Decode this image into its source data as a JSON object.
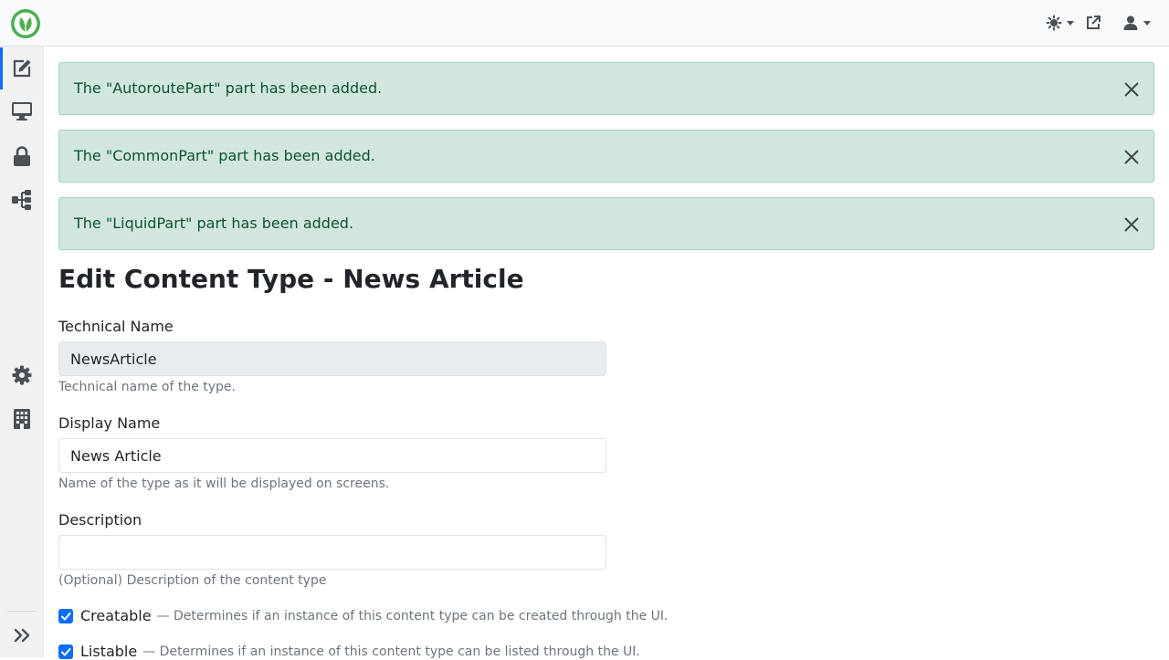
{
  "colors": {
    "accent": "#0d6efd",
    "alert_bg": "#d1e7dd",
    "alert_text": "#0f5132",
    "logo_green": "#4caf50"
  },
  "header": {
    "logo_icon": "leaf-logo-icon",
    "actions": [
      {
        "icon": "theme-toggle-icon",
        "dropdown": true
      },
      {
        "icon": "external-link-icon",
        "dropdown": false
      },
      {
        "icon": "user-icon",
        "dropdown": true
      }
    ]
  },
  "sidebar": {
    "items": [
      {
        "icon": "edit-icon",
        "active": true
      },
      {
        "icon": "desktop-icon",
        "active": false
      },
      {
        "icon": "lock-icon",
        "active": false
      },
      {
        "icon": "workflow-icon",
        "active": false
      },
      {
        "icon": "gear-icon",
        "active": false
      },
      {
        "icon": "building-icon",
        "active": false
      }
    ],
    "collapse_icon": "double-chevron-right-icon"
  },
  "alerts": [
    {
      "message": "The \"AutoroutePart\" part has been added."
    },
    {
      "message": "The \"CommonPart\" part has been added."
    },
    {
      "message": "The \"LiquidPart\" part has been added."
    }
  ],
  "page": {
    "title": "Edit Content Type - News Article"
  },
  "form": {
    "technical_name": {
      "label": "Technical Name",
      "value": "NewsArticle",
      "hint": "Technical name of the type."
    },
    "display_name": {
      "label": "Display Name",
      "value": "News Article",
      "hint": "Name of the type as it will be displayed on screens."
    },
    "description": {
      "label": "Description",
      "value": "",
      "hint": "(Optional) Description of the content type"
    },
    "creatable": {
      "label": "Creatable",
      "hint": "— Determines if an instance of this content type can be created through the UI.",
      "checked": true
    },
    "listable": {
      "label": "Listable",
      "hint": "— Determines if an instance of this content type can be listed through the UI.",
      "checked": true
    }
  }
}
